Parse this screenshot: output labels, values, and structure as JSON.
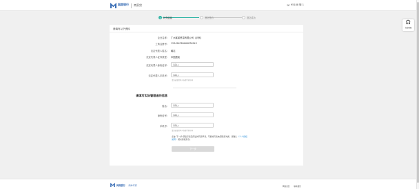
{
  "header": {
    "logo_cn": "网商银行",
    "logo_en": "MYbank",
    "subtitle": "商家贷",
    "hotline": "95188 转 1"
  },
  "steps": [
    {
      "number": "1",
      "label": "补充信息"
    },
    {
      "number": "2",
      "label": "提交签约"
    },
    {
      "number": "3",
      "label": "提交成功"
    }
  ],
  "form": {
    "heading": "请填写以下资料",
    "fields": [
      {
        "label": "企业名称:",
        "value": "广州某某贸易有限公司（示例）"
      },
      {
        "label": "工商注册号:",
        "value": "123456789009876543"
      },
      {
        "label": "法定代表人姓名:",
        "value": "韩志"
      },
      {
        "label": "法定代表人证件类型:",
        "value": "中国居民"
      }
    ],
    "legal_id_label": "法定代表人身份证号:",
    "legal_id_placeholder": "请输入",
    "legal_phone_label": "法定代表人手机号:",
    "legal_phone_placeholder": "请输入",
    "legal_phone_hint": "请务必使用本人办理手机号码",
    "section2_title": "请填写实际管理者的信息",
    "name_label": "姓名:",
    "name_placeholder": "请输入",
    "idcard_label": "身份证号:",
    "idcard_placeholder": "请输入",
    "phone_label": "手机号:",
    "phone_placeholder": "请输入",
    "phone_hint": "请务必使用本人办理手机号码",
    "notice_text": "点击\"下一步\"即表示您已阅读并同意申请，可能将与您电话联系沟通，请确认",
    "notice_link": "《个人授权说明》",
    "notice_tail": "相关授权条款。",
    "next_button": "下一步"
  },
  "help_widget": {
    "icon": "headset-icon",
    "label": "在线客服"
  },
  "footer": {
    "logo_cn": "网商银行",
    "slogan": "无微不至",
    "links": [
      "网商首页",
      "联系我们"
    ]
  },
  "colors": {
    "accent": "#2fb5a5",
    "brand": "#3b6fb6",
    "link": "#2a8fd8"
  }
}
